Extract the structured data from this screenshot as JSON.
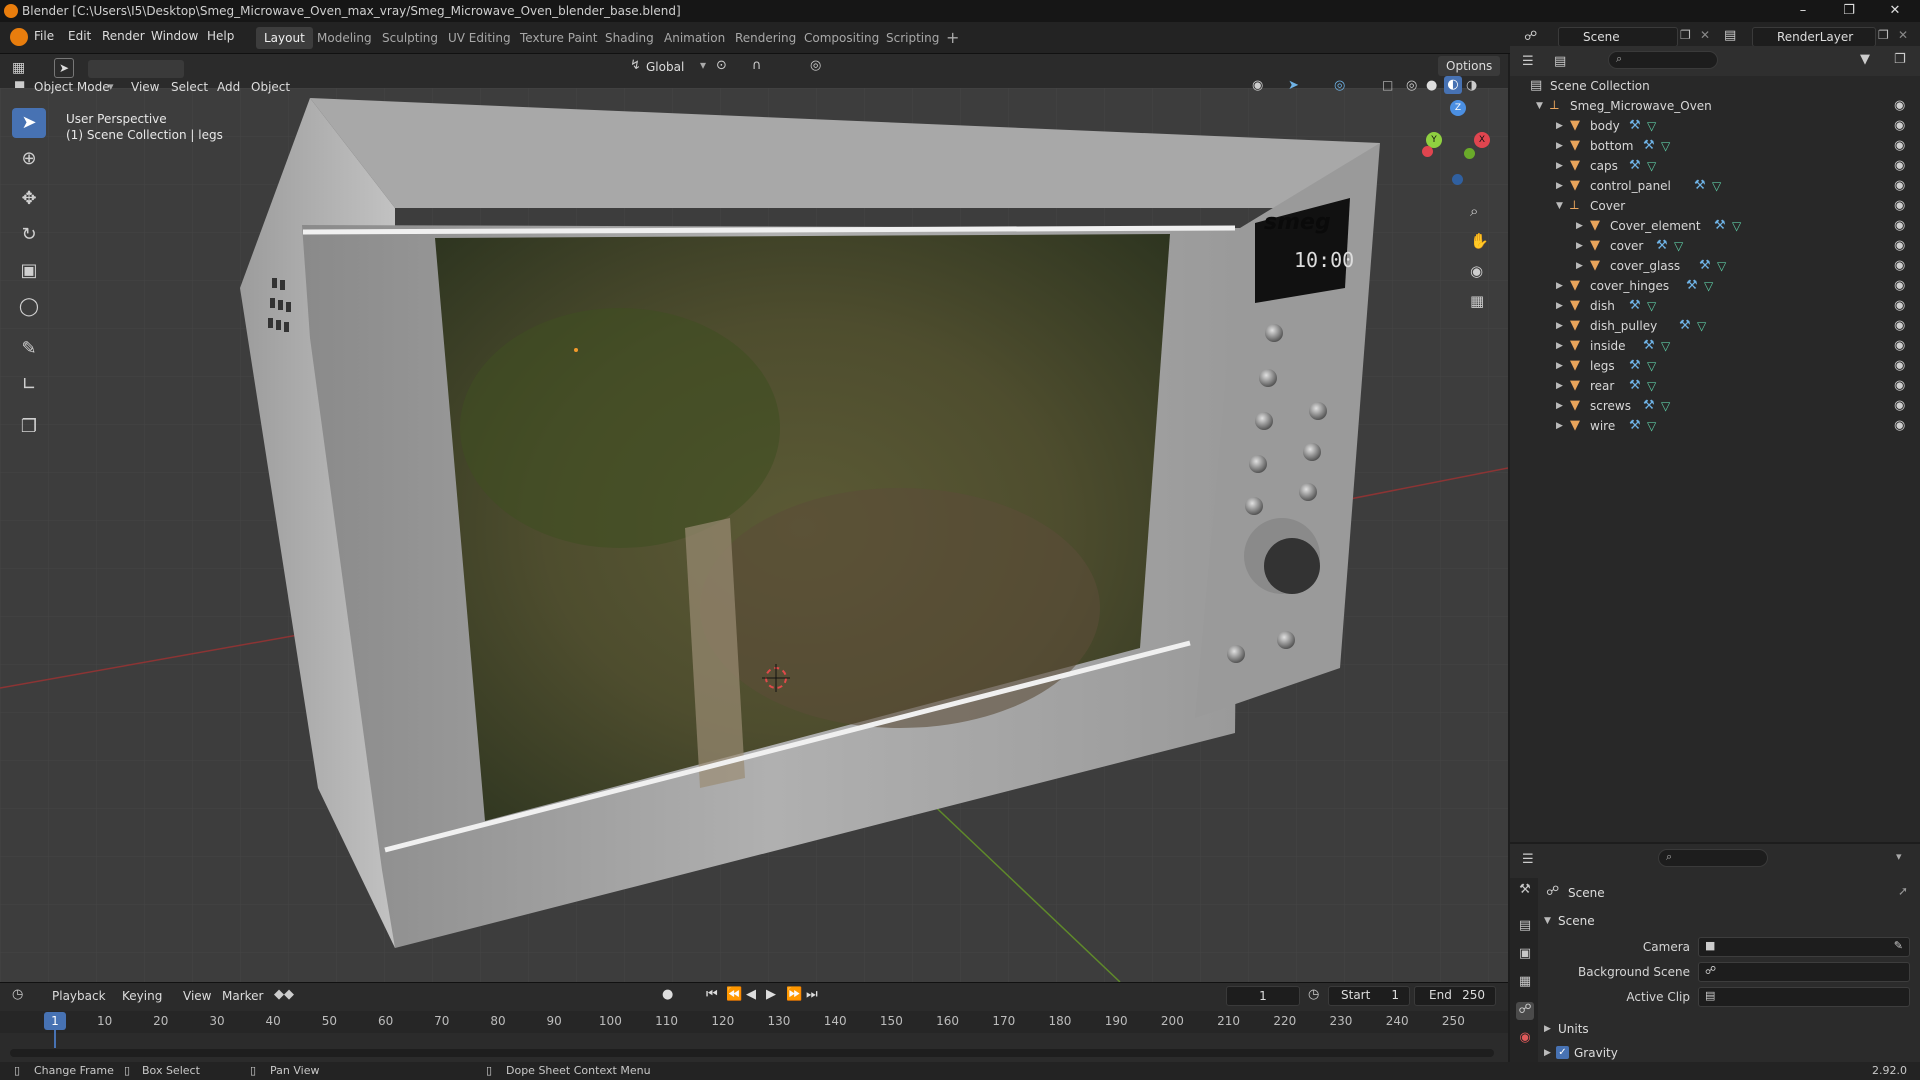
{
  "window": {
    "title": "Blender [C:\\Users\\I5\\Desktop\\Smeg_Microwave_Oven_max_vray/Smeg_Microwave_Oven_blender_base.blend]"
  },
  "menu": [
    "File",
    "Edit",
    "Render",
    "Window",
    "Help"
  ],
  "workspaces": [
    {
      "label": "Layout",
      "active": true
    },
    {
      "label": "Modeling"
    },
    {
      "label": "Sculpting"
    },
    {
      "label": "UV Editing"
    },
    {
      "label": "Texture Paint"
    },
    {
      "label": "Shading"
    },
    {
      "label": "Animation"
    },
    {
      "label": "Rendering"
    },
    {
      "label": "Compositing"
    },
    {
      "label": "Scripting"
    }
  ],
  "scene_selector": {
    "value": "Scene",
    "render_layer": "RenderLayer"
  },
  "viewport_header": {
    "mode": "Object Mode",
    "menus": [
      "View",
      "Select",
      "Add",
      "Object"
    ],
    "orientation": "Global",
    "options_label": "Options"
  },
  "viewport": {
    "perspective": "User Perspective",
    "collection_info": "(1) Scene Collection | legs",
    "brand": "smeg",
    "display_time": "10:00"
  },
  "gizmo": {
    "z": "Z",
    "y": "Y",
    "x": "X"
  },
  "outliner": {
    "root": "Scene Collection",
    "collection": "Smeg_Microwave_Oven",
    "items": [
      {
        "name": "body",
        "level": 1
      },
      {
        "name": "bottom",
        "level": 1
      },
      {
        "name": "caps",
        "level": 1
      },
      {
        "name": "control_panel",
        "level": 1
      },
      {
        "name": "Cover",
        "level": 1,
        "expanded": true
      },
      {
        "name": "Cover_element",
        "level": 2
      },
      {
        "name": "cover",
        "level": 2
      },
      {
        "name": "cover_glass",
        "level": 2
      },
      {
        "name": "cover_hinges",
        "level": 1
      },
      {
        "name": "dish",
        "level": 1
      },
      {
        "name": "dish_pulley",
        "level": 1
      },
      {
        "name": "inside",
        "level": 1
      },
      {
        "name": "legs",
        "level": 1
      },
      {
        "name": "rear",
        "level": 1
      },
      {
        "name": "screws",
        "level": 1
      },
      {
        "name": "wire",
        "level": 1
      }
    ]
  },
  "properties": {
    "context": "Scene",
    "panel": "Scene",
    "fields": [
      {
        "label": "Camera"
      },
      {
        "label": "Background Scene"
      },
      {
        "label": "Active Clip"
      }
    ],
    "sections": [
      {
        "label": "Units",
        "checkbox": false
      },
      {
        "label": "Gravity",
        "checkbox": true
      }
    ]
  },
  "timeline": {
    "menus": [
      "Playback",
      "Keying",
      "View",
      "Marker"
    ],
    "current_frame": "1",
    "start_label": "Start",
    "start": "1",
    "end_label": "End",
    "end": "250",
    "ticks": [
      "1",
      "10",
      "20",
      "30",
      "40",
      "50",
      "60",
      "70",
      "80",
      "90",
      "100",
      "110",
      "120",
      "130",
      "140",
      "150",
      "160",
      "170",
      "180",
      "190",
      "200",
      "210",
      "220",
      "230",
      "240",
      "250"
    ]
  },
  "statusbar": {
    "items": [
      "Change Frame",
      "Box Select",
      "Pan View",
      "Dope Sheet Context Menu"
    ],
    "version": "2.92.0"
  },
  "colors": {
    "accent": "#4772b3",
    "orange": "#e87d0d"
  }
}
